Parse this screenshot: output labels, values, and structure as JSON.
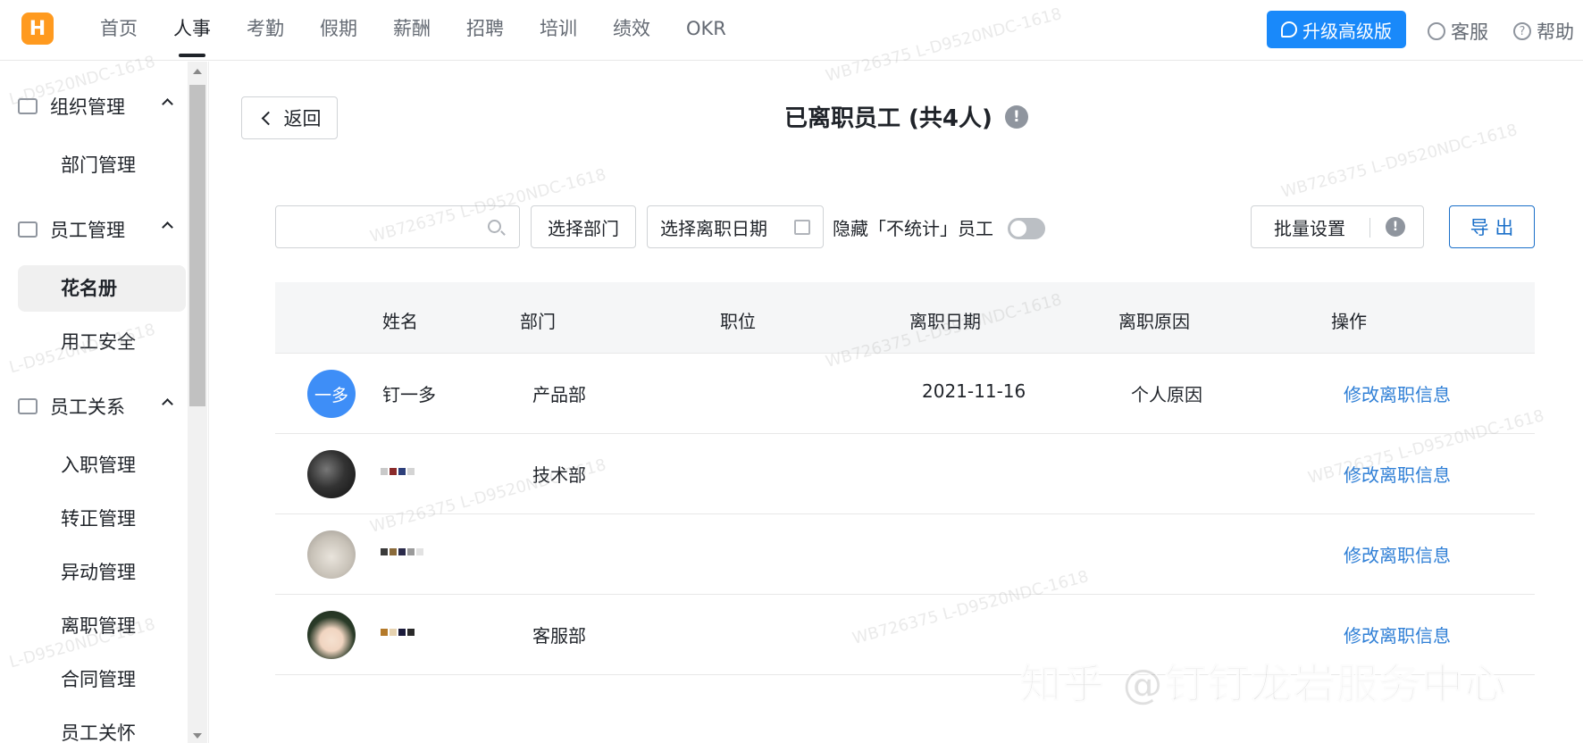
{
  "topbar": {
    "logo_text": "H",
    "nav": [
      "首页",
      "人事",
      "考勤",
      "假期",
      "薪酬",
      "招聘",
      "培训",
      "绩效",
      "OKR"
    ],
    "active_nav_index": 1,
    "upgrade_label": "升级高级版",
    "service_label": "客服",
    "help_label": "帮助",
    "help_icon_glyph": "?"
  },
  "sidebar": {
    "groups": [
      {
        "label": "组织管理",
        "icon": "org-chart-icon"
      },
      {
        "label": "员工管理",
        "icon": "employee-folder-icon"
      },
      {
        "label": "员工关系",
        "icon": "relation-icon"
      }
    ],
    "items": [
      "部门管理",
      "花名册",
      "用工安全",
      "入职管理",
      "转正管理",
      "异动管理",
      "离职管理",
      "合同管理",
      "员工关怀"
    ],
    "active_item": "花名册"
  },
  "main": {
    "back_label": "返回",
    "title": "已离职员工 (共4人)",
    "info_glyph": "!",
    "search": {
      "value": "",
      "placeholder": ""
    },
    "dept_select": "选择部门",
    "date_select": "选择离职日期",
    "hide_label": "隐藏「不统计」员工",
    "hide_toggle_on": false,
    "batch_label": "批量设置",
    "export_label": "导 出"
  },
  "table": {
    "columns": [
      "姓名",
      "部门",
      "职位",
      "离职日期",
      "离职原因",
      "操作"
    ],
    "rows": [
      {
        "avatar_text": "一多",
        "name": "钉一多",
        "dept": "产品部",
        "position": "",
        "date": "2021-11-16",
        "reason": "个人原因",
        "action": "修改离职信息"
      },
      {
        "avatar_text": "",
        "name": "",
        "dept": "技术部",
        "position": "",
        "date": "",
        "reason": "",
        "action": "修改离职信息"
      },
      {
        "avatar_text": "",
        "name": "",
        "dept": "",
        "position": "",
        "date": "",
        "reason": "",
        "action": "修改离职信息"
      },
      {
        "avatar_text": "",
        "name": "",
        "dept": "客服部",
        "position": "",
        "date": "",
        "reason": "",
        "action": "修改离职信息"
      }
    ]
  },
  "watermark_text": "WB726375 L-D9520NDC-1618",
  "watermark_short": "L-D9520NDC-1618",
  "brand_watermark": "知乎 @钉钉龙岩服务中心",
  "colors": {
    "accent": "#1989fa",
    "link": "#2f7fd6",
    "logo": "#ff9a1f"
  }
}
